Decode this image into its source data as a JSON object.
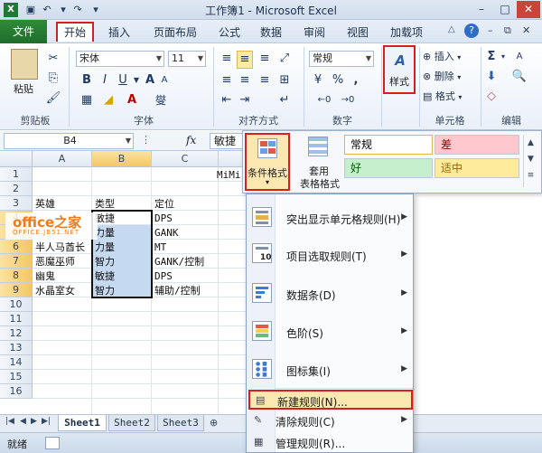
{
  "window": {
    "title": "工作簿1 - Microsoft Excel",
    "undo_icon": "undo-icon",
    "save_icon": "save-icon"
  },
  "tabs": [
    {
      "id": "file",
      "label": "文件"
    },
    {
      "id": "home",
      "label": "开始"
    },
    {
      "id": "insert",
      "label": "插入"
    },
    {
      "id": "pagelayout",
      "label": "页面布局"
    },
    {
      "id": "formulas",
      "label": "公式"
    },
    {
      "id": "data",
      "label": "数据"
    },
    {
      "id": "review",
      "label": "审阅"
    },
    {
      "id": "view",
      "label": "视图"
    },
    {
      "id": "addins",
      "label": "加载项"
    }
  ],
  "ribbon": {
    "clipboard": {
      "label": "剪贴板",
      "paste": "粘贴"
    },
    "font": {
      "label": "字体",
      "font_name": "宋体",
      "font_size": "11",
      "bold": "B",
      "italic": "I",
      "underline": "U",
      "font_color_glyph": "A",
      "grow": "A",
      "shrink": "A",
      "phonetic": "燮"
    },
    "alignment": {
      "label": "对齐方式"
    },
    "number": {
      "label": "数字",
      "format": "常规",
      "percent": "%",
      "comma": ","
    },
    "styles": {
      "label": "样式"
    },
    "cells": {
      "label": "单元格",
      "insert": "插入",
      "delete": "删除",
      "format": "格式"
    },
    "editing": {
      "label": "编辑",
      "sum": "Σ",
      "sort": "A",
      "sort2": "Z"
    }
  },
  "formula_bar": {
    "name_box": "B4",
    "fx": "fx",
    "content": "敏捷"
  },
  "styles_panel": {
    "conditional_formatting": "条件格式",
    "format_as_table_line1": "套用",
    "format_as_table_line2": "表格格式",
    "cell_styles": [
      {
        "label": "常规",
        "bg": "#ffffff",
        "color": "#000000"
      },
      {
        "label": "差",
        "bg": "#ffc7ce",
        "color": "#9c0006"
      },
      {
        "label": "好",
        "bg": "#c6efce",
        "color": "#006100"
      },
      {
        "label": "适中",
        "bg": "#ffeb9c",
        "color": "#9c6500"
      }
    ]
  },
  "menu": {
    "items": [
      {
        "label": "突出显示单元格规则(H)",
        "has_submenu": true
      },
      {
        "label": "项目选取规则(T)",
        "has_submenu": true
      },
      {
        "label": "数据条(D)",
        "has_submenu": true
      },
      {
        "label": "色阶(S)",
        "has_submenu": true
      },
      {
        "label": "图标集(I)",
        "has_submenu": true
      },
      {
        "label": "新建规则(N)...",
        "has_submenu": false
      },
      {
        "label": "清除规则(C)",
        "has_submenu": true
      },
      {
        "label": "管理规则(R)...",
        "has_submenu": false
      }
    ]
  },
  "grid": {
    "columns": [
      "A",
      "B",
      "C"
    ],
    "rows": [
      "1",
      "2",
      "3",
      "4",
      "5",
      "6",
      "7",
      "8",
      "9",
      "10",
      "11",
      "12",
      "13",
      "14",
      "15",
      "16"
    ],
    "cells": {
      "D1": "MiMi",
      "A3": "英雄",
      "B3": "类型",
      "C3": "定位",
      "A4": "",
      "B4": "敏捷",
      "C4": "DPS",
      "A5": "",
      "B5": "力量",
      "C5": "GANK",
      "A6": "半人马酋长",
      "B6": "力量",
      "C6": "MT",
      "A7": "恶魔巫师",
      "B7": "智力",
      "C7": "GANK/控制",
      "A8": "幽鬼",
      "B8": "敏捷",
      "C8": "DPS",
      "A9": "水晶室女",
      "B9": "智力",
      "C9": "辅助/控制"
    },
    "watermark_main": "office之家",
    "watermark_sub": "OFFICE.JB51.NET"
  },
  "sheets": [
    "Sheet1",
    "Sheet2",
    "Sheet3"
  ],
  "status": {
    "ready": "就绪"
  },
  "colors": {
    "accent_red": "#d62020",
    "file_tab": "#2a7d34",
    "selection": "#c5d9f1"
  }
}
